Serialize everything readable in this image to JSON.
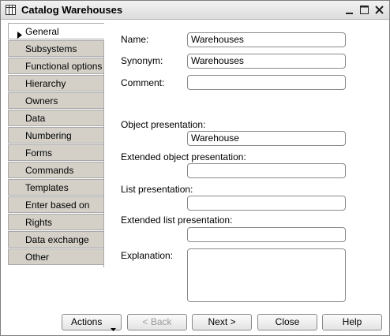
{
  "window": {
    "title": "Catalog Warehouses"
  },
  "tabs": [
    {
      "label": "General",
      "active": true
    },
    {
      "label": "Subsystems"
    },
    {
      "label": "Functional options"
    },
    {
      "label": "Hierarchy"
    },
    {
      "label": "Owners"
    },
    {
      "label": "Data"
    },
    {
      "label": "Numbering"
    },
    {
      "label": "Forms"
    },
    {
      "label": "Commands"
    },
    {
      "label": "Templates"
    },
    {
      "label": "Enter based on"
    },
    {
      "label": "Rights"
    },
    {
      "label": "Data exchange"
    },
    {
      "label": "Other"
    }
  ],
  "form": {
    "name_label": "Name:",
    "name_value": "Warehouses",
    "synonym_label": "Synonym:",
    "synonym_value": "Warehouses",
    "comment_label": "Comment:",
    "comment_value": "",
    "object_presentation_label": "Object presentation:",
    "object_presentation_value": "Warehouse",
    "extended_object_presentation_label": "Extended object presentation:",
    "extended_object_presentation_value": "",
    "list_presentation_label": "List presentation:",
    "list_presentation_value": "",
    "extended_list_presentation_label": "Extended list presentation:",
    "extended_list_presentation_value": "",
    "explanation_label": "Explanation:",
    "explanation_value": ""
  },
  "buttons": {
    "actions": "Actions",
    "back": "< Back",
    "next": "Next >",
    "close": "Close",
    "help": "Help"
  },
  "icons": {
    "title": "catalog-table-icon",
    "minimize": "minimize-icon",
    "maximize": "maximize-icon",
    "close": "close-icon",
    "active_tab": "triangle-right-icon",
    "actions_dropdown": "dropdown-arrow-icon"
  }
}
